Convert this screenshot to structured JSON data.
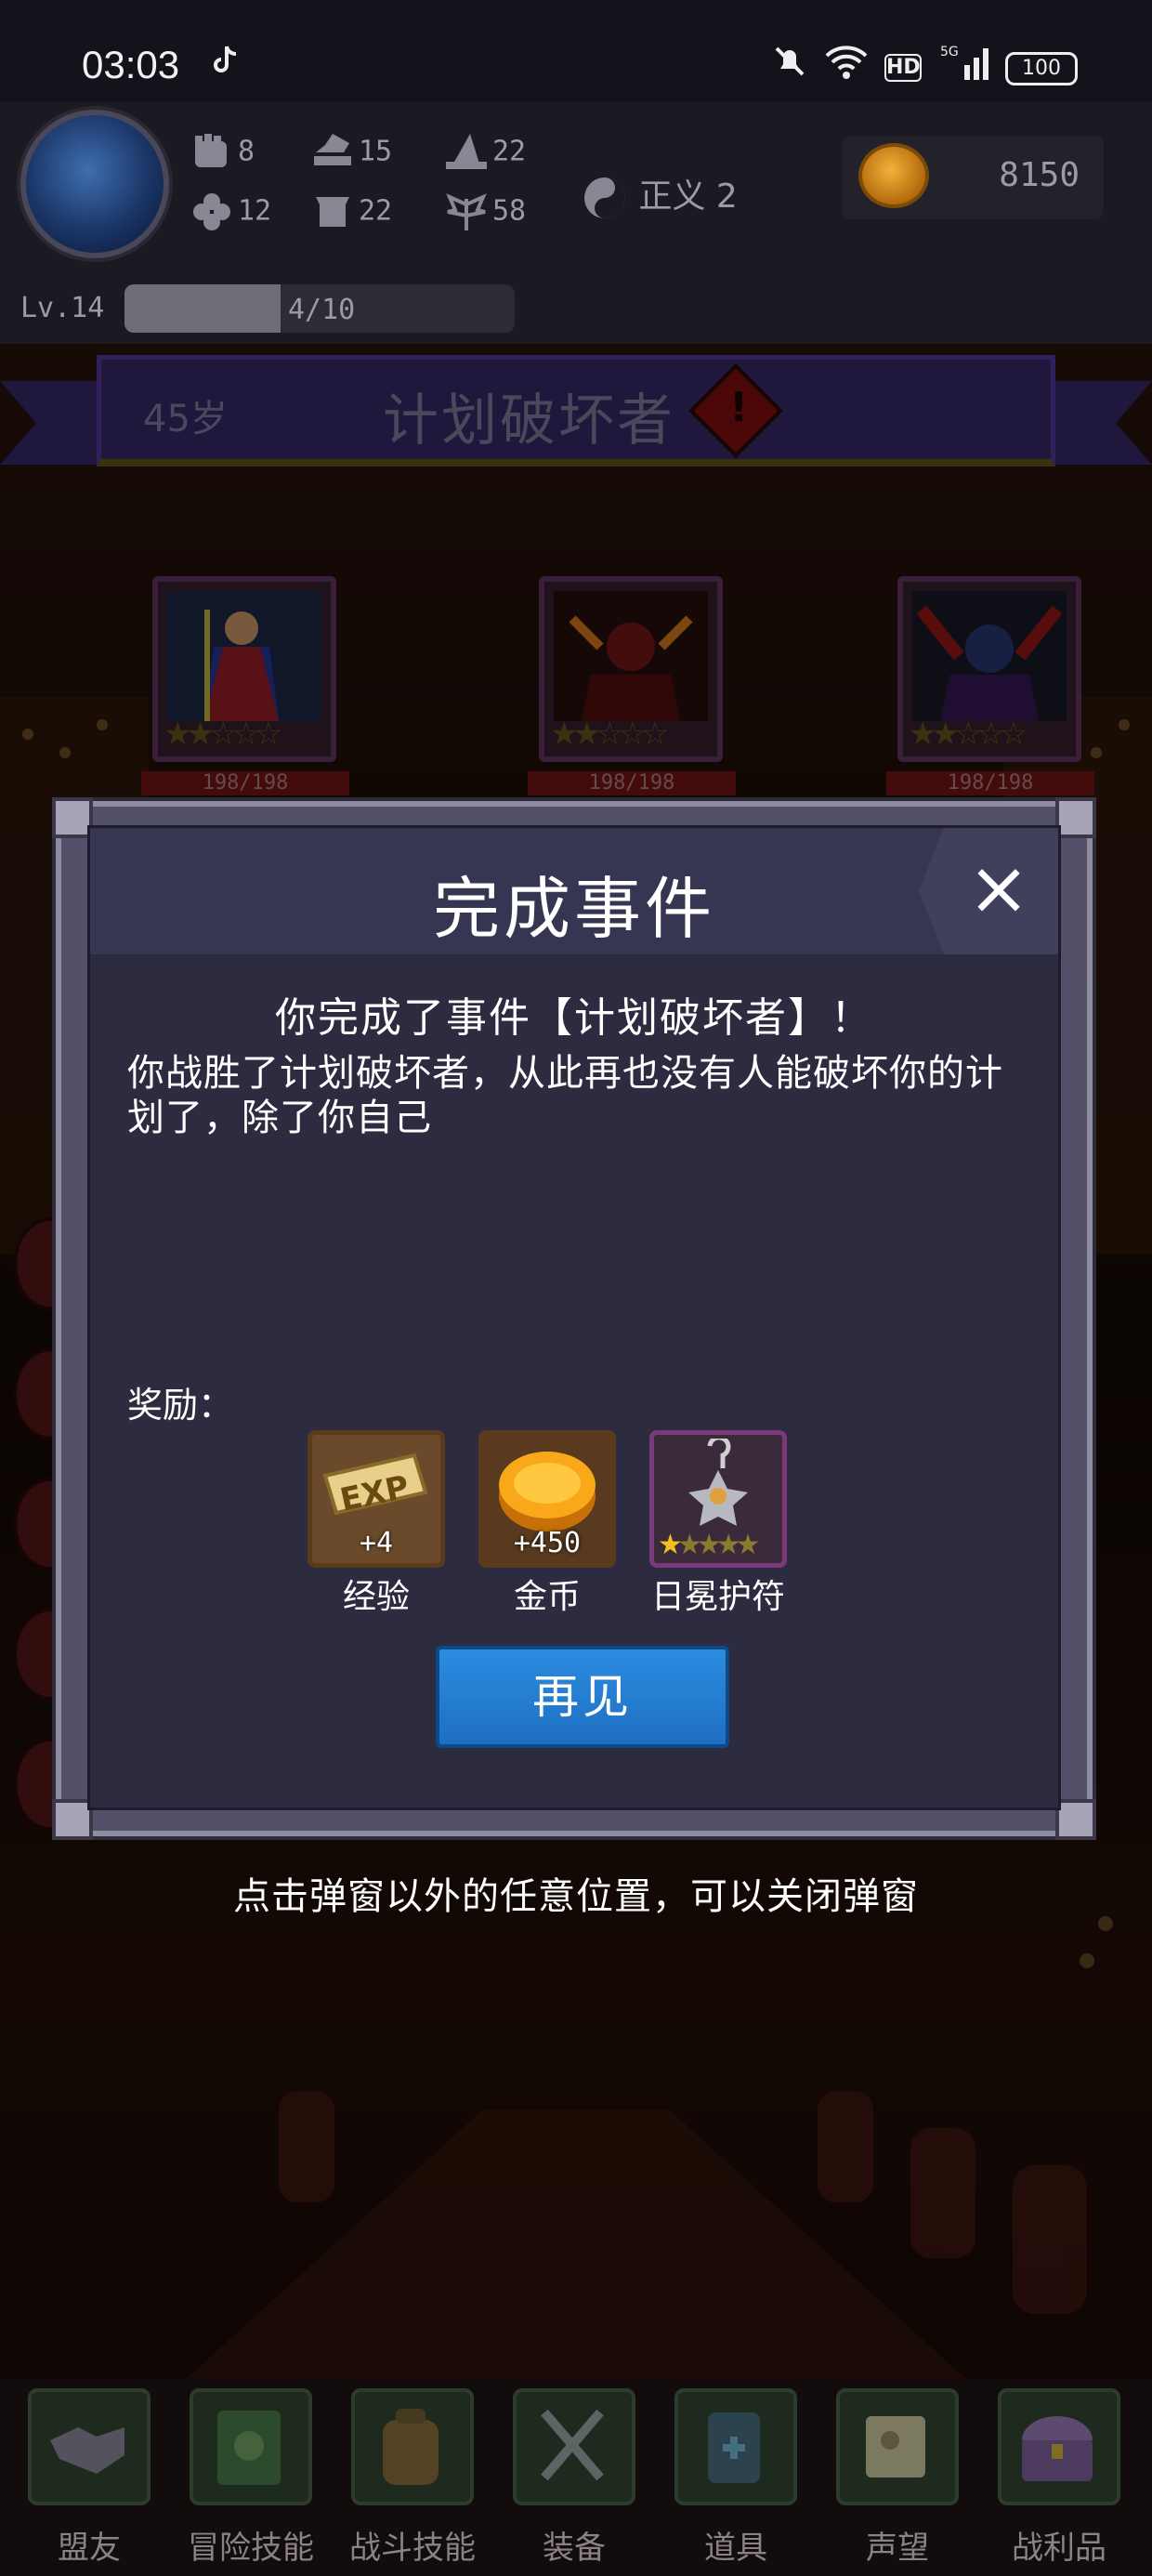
{
  "status_bar": {
    "time": "03:03",
    "battery": "100"
  },
  "hud": {
    "stats": {
      "strength": "8",
      "agility": "15",
      "magic": "22",
      "luck": "12",
      "defense": "22",
      "spirit": "58"
    },
    "justice_label": "正义 2",
    "gold": "8150",
    "level": "Lv.14",
    "xp_text": "4/10",
    "xp_fraction": 0.4
  },
  "banner": {
    "age": "45岁",
    "event_name": "计划破坏者",
    "alert_symbol": "!"
  },
  "enemies": [
    {
      "hp": "198/198"
    },
    {
      "hp": "198/198"
    },
    {
      "hp": "198/198"
    }
  ],
  "dialog": {
    "title": "完成事件",
    "close_symbol": "×",
    "subtitle": "你完成了事件【计划破坏者】！",
    "body": "你战胜了计划破坏者，从此再也没有人能破坏你的计划了，除了你自己",
    "reward_label": "奖励：",
    "rewards": [
      {
        "name": "经验",
        "qty": "+4",
        "icon": "exp-scroll-icon"
      },
      {
        "name": "金币",
        "qty": "+450",
        "icon": "gold-coin-icon"
      },
      {
        "name": "日冕护符",
        "qty": "",
        "icon": "amulet-icon"
      }
    ],
    "confirm_label": "再见"
  },
  "hint": "点击弹窗以外的任意位置，可以关闭弹窗",
  "nav": [
    {
      "label": "盟友",
      "icon": "handshake-icon"
    },
    {
      "label": "冒险技能",
      "icon": "book-icon"
    },
    {
      "label": "战斗技能",
      "icon": "backpack-icon"
    },
    {
      "label": "装备",
      "icon": "armor-icon"
    },
    {
      "label": "道具",
      "icon": "items-icon"
    },
    {
      "label": "声望",
      "icon": "scroll-icon"
    },
    {
      "label": "战利品",
      "icon": "treasure-chest-icon"
    }
  ],
  "colors": {
    "accent_blue": "#2c8ce0",
    "banner_purple": "#3a2a6e",
    "dialog_bg": "#2d2b40"
  }
}
